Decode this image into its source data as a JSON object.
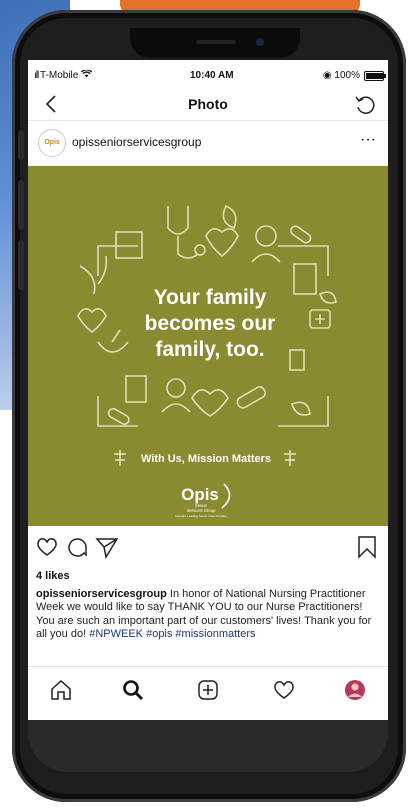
{
  "status": {
    "carrier": "T-Mobile",
    "time": "10:40 AM",
    "battery": "100%",
    "battery_level": 1.0
  },
  "nav": {
    "title": "Photo",
    "back_icon": "chevron-left-icon",
    "refresh_icon": "refresh-icon"
  },
  "post": {
    "avatar_text": "Opis",
    "username": "opisseniorservicesgroup",
    "more_icon": "more-horizontal-icon",
    "more_symbol": "···",
    "image": {
      "headline_line1": "Your family",
      "headline_line2": "becomes our",
      "headline_line3": "family, too.",
      "tagline": "With Us, Mission Matters",
      "logo_text": "Opis",
      "logo_sub1": "Senior",
      "logo_sub2": "Services Group",
      "logo_fine": "Florida's Leading Senior Care Provider",
      "background_color": "#8a8a30"
    },
    "likes": "4 likes",
    "caption_username": "opisseniorservicesgroup",
    "caption_text": "In honor of National Nursing Practitioner Week we would like to say THANK YOU to our Nurse Practitioners! You are such an important part of our customers' lives!  Thank you for all you do!",
    "caption_tags_1": "#NPWEEK",
    "caption_tags_2": "#opis #missionmatters"
  },
  "tabs": [
    {
      "icon": "home-icon"
    },
    {
      "icon": "search-icon"
    },
    {
      "icon": "add-post-icon"
    },
    {
      "icon": "activity-heart-icon"
    },
    {
      "icon": "profile-avatar-icon"
    }
  ]
}
